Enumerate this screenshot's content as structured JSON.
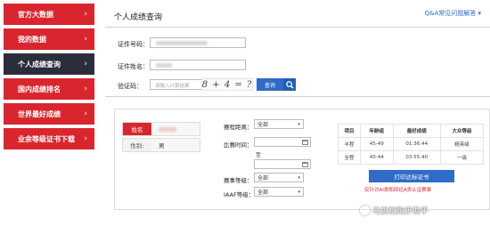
{
  "sidebar": {
    "items": [
      {
        "label": "官方大数据"
      },
      {
        "label": "我的数据"
      },
      {
        "label": "个人成绩查询"
      },
      {
        "label": "国内成绩排名"
      },
      {
        "label": "世界最好成绩"
      },
      {
        "label": "业余等级证书下载"
      }
    ],
    "active_index": 2,
    "chevron": "›"
  },
  "header": {
    "title": "个人成绩查询",
    "qa_link": "Q&A常见问题解答"
  },
  "form": {
    "id_label": "证件号码：",
    "name_label": "证件姓名：",
    "captcha_label": "验证码：",
    "captcha_placeholder": "请输入计算结果",
    "captcha_text": "8 + 4 = ?",
    "query_button": "查询"
  },
  "profile": {
    "name_key": "姓名",
    "gender_key": "性别:",
    "gender_value": "男"
  },
  "filters": {
    "distance_label": "赛程距离：",
    "distance_value": "全部",
    "time_label": "比赛时间：",
    "to_label": "至",
    "level_label": "赛事等级：",
    "level_value": "全部",
    "iaaf_label": "IAAF等级：",
    "iaaf_value": "全部"
  },
  "results": {
    "headers": [
      "项目",
      "年龄组",
      "最好成绩",
      "大众等级"
    ],
    "rows": [
      [
        "半程",
        "45-49",
        "01:36:44",
        "精英级"
      ],
      [
        "全程",
        "40-44",
        "03:55:40",
        "一级"
      ]
    ],
    "cert_button": "打印达标证书",
    "cert_note": "仅针对AI类和田径A类认证赛事"
  },
  "watermark": {
    "text": "马拉松跑步助手"
  },
  "colors": {
    "brand_red": "#d9262e",
    "active_dark": "#2b2d3b",
    "button_blue": "#2f6bc7"
  }
}
